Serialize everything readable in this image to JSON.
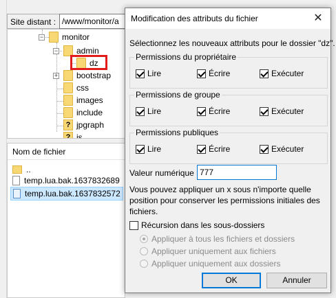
{
  "background": {
    "site_label": "Site distant :",
    "site_path": "/www/monitor/a",
    "tree": [
      {
        "label": "monitor",
        "icon": "folder-icon",
        "expanded": true
      },
      {
        "label": "admin",
        "icon": "folder-icon",
        "expanded": true
      },
      {
        "label": "dz",
        "icon": "folder-icon",
        "selected": true
      },
      {
        "label": "bootstrap",
        "icon": "folder-icon"
      },
      {
        "label": "css",
        "icon": "folder-icon"
      },
      {
        "label": "images",
        "icon": "folder-icon"
      },
      {
        "label": "include",
        "icon": "folder-icon"
      },
      {
        "label": "jpgraph",
        "icon": "unknown-folder-icon"
      },
      {
        "label": "js",
        "icon": "unknown-folder-icon"
      }
    ],
    "files_header": "Nom de fichier",
    "files": [
      {
        "name": "..",
        "icon": "folder-icon"
      },
      {
        "name": "temp.lua.bak.1637832689",
        "icon": "file-icon"
      },
      {
        "name": "temp.lua.bak.1637832572",
        "icon": "file-icon",
        "selected": true
      }
    ],
    "highlight_color": "#e21b1b"
  },
  "dialog": {
    "title": "Modification des attributs du fichier",
    "close_icon": "close-icon",
    "intro": "Sélectionnez les nouveaux attributs pour le dossier \"dz\".",
    "groups": [
      {
        "title": "Permissions du propriétaire",
        "read": "Lire",
        "write": "Écrire",
        "execute": "Exécuter",
        "read_checked": true,
        "write_checked": true,
        "execute_checked": true
      },
      {
        "title": "Permissions de groupe",
        "read": "Lire",
        "write": "Écrire",
        "execute": "Exécuter",
        "read_checked": true,
        "write_checked": true,
        "execute_checked": true
      },
      {
        "title": "Permissions publiques",
        "read": "Lire",
        "write": "Écrire",
        "execute": "Exécuter",
        "read_checked": true,
        "write_checked": true,
        "execute_checked": true
      }
    ],
    "numeric_label": "Valeur numérique :",
    "numeric_value": "777",
    "hint_lines": [
      "Vous pouvez appliquer un x sous n'importe quelle",
      "position pour conserver les permissions initiales des",
      "fichiers."
    ],
    "recursion_label": "Récursion dans les sous-dossiers",
    "recursion_checked": false,
    "radio_options": [
      {
        "label": "Appliquer à tous les fichiers et dossiers",
        "selected": true
      },
      {
        "label": "Appliquer uniquement aux fichiers",
        "selected": false
      },
      {
        "label": "Appliquer uniquement aux dossiers",
        "selected": false
      }
    ],
    "ok_label": "OK",
    "cancel_label": "Annuler",
    "accent_color": "#0078d7"
  }
}
